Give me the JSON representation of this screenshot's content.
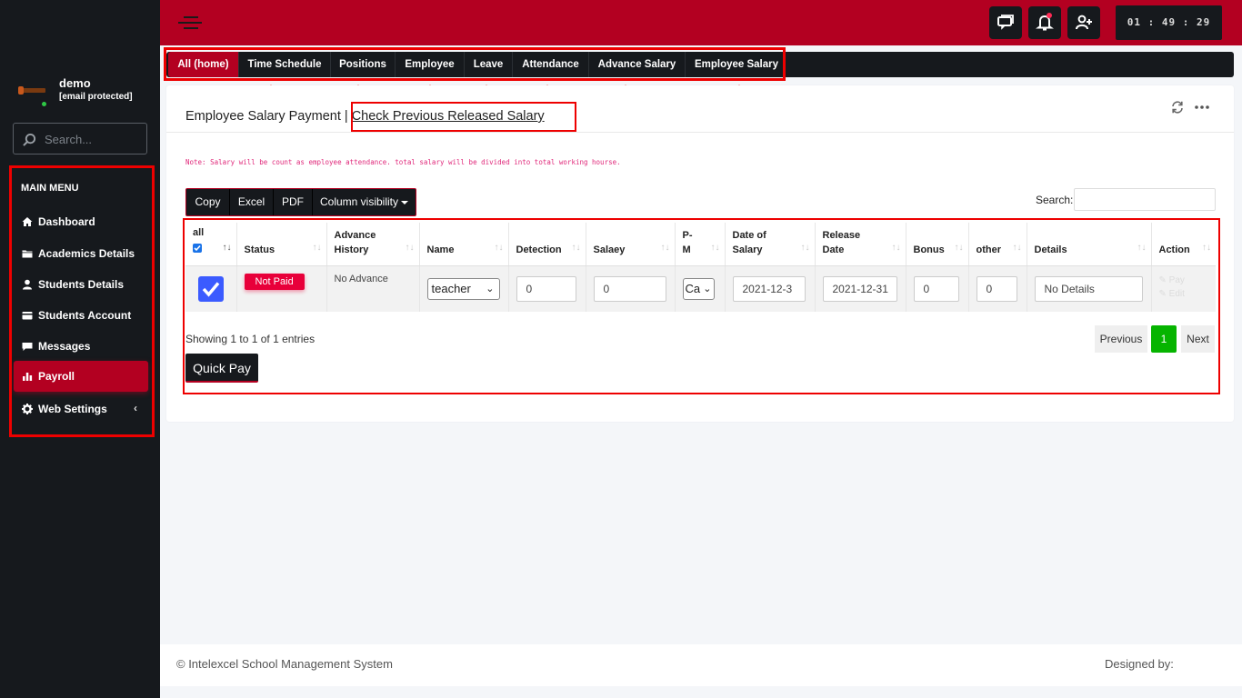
{
  "user": {
    "name": "demo",
    "email": "[email protected]"
  },
  "sidebar": {
    "search_placeholder": "Search...",
    "menu_header": "MAIN MENU",
    "items": [
      {
        "label": "Dashboard",
        "icon": "home-icon"
      },
      {
        "label": "Academics Details",
        "icon": "folder-icon"
      },
      {
        "label": "Students Details",
        "icon": "user-icon"
      },
      {
        "label": "Students Account",
        "icon": "card-icon"
      },
      {
        "label": "Messages",
        "icon": "chat-icon"
      },
      {
        "label": "Payroll",
        "icon": "bar-chart-icon",
        "active": true
      },
      {
        "label": "Web Settings",
        "icon": "gear-icon"
      }
    ]
  },
  "topbar": {
    "clock": "01 : 49 : 29",
    "buttons": [
      "chat-icon",
      "bell-icon",
      "user-plus-icon"
    ]
  },
  "tabs": [
    "All (home)",
    "Time Schedule",
    "Positions",
    "Employee",
    "Leave",
    "Attendance",
    "Advance Salary",
    "Employee Salary"
  ],
  "card": {
    "title": "Employee Salary Payment",
    "separator": "|",
    "link": "Check Previous Released Salary",
    "note": "Note: Salary will be count as employee attendance. total salary will be divided into total working hourse."
  },
  "dt_buttons": [
    "Copy",
    "Excel",
    "PDF",
    "Column visibility"
  ],
  "search_label": "Search:",
  "table": {
    "headers": [
      "all",
      "Status",
      "Advance History",
      "Name",
      "Detection",
      "Salaey",
      "P-M",
      "Date of Salary",
      "Release Date",
      "Bonus",
      "other",
      "Details",
      "Action"
    ],
    "row": {
      "status": "Not Paid",
      "advance": "No Advance",
      "name": "teacher",
      "detection": "0",
      "salary": "0",
      "pm": "Ca",
      "date_of_salary": "2021-12-3",
      "release_date": "2021-12-31",
      "bonus": "0",
      "other": "0",
      "details": "No Details",
      "action_pay": "Pay",
      "action_edit": "Edit"
    }
  },
  "showing": "Showing 1 to 1 of 1 entries",
  "pager": {
    "previous": "Previous",
    "page": "1",
    "next": "Next"
  },
  "quick_pay": "Quick Pay",
  "footer": {
    "left": "© Intelexcel School Management System",
    "right": "Designed by:"
  },
  "colors": {
    "brand": "#b30021",
    "dark": "#16191d",
    "success": "#06b400",
    "badge": "#e8003a",
    "annotation": "#ee0000"
  }
}
